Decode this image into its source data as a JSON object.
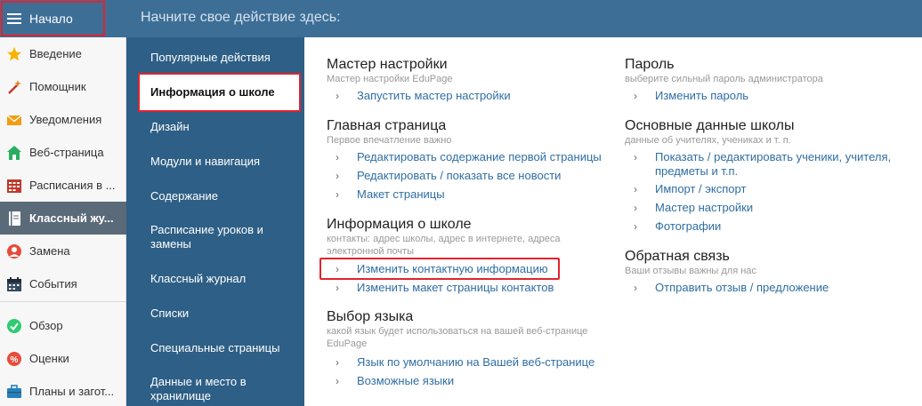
{
  "header": {
    "title": "Начните свое действие здесь:"
  },
  "sidebar": {
    "start_label": "Начало",
    "items": [
      {
        "label": "Введение",
        "icon": "star-icon"
      },
      {
        "label": "Помощник",
        "icon": "magic-wand-icon"
      },
      {
        "label": "Уведомления",
        "icon": "envelope-icon"
      },
      {
        "label": "Веб-страница",
        "icon": "home-icon"
      },
      {
        "label": "Расписания в ...",
        "icon": "timetable-icon"
      },
      {
        "label": "Классный жу...",
        "icon": "notebook-icon"
      },
      {
        "label": "Замена",
        "icon": "substitution-icon"
      },
      {
        "label": "События",
        "icon": "calendar-icon"
      },
      {
        "label": "Обзор",
        "icon": "check-circle-icon"
      },
      {
        "label": "Оценки",
        "icon": "grades-icon"
      },
      {
        "label": "Планы и загот...",
        "icon": "briefcase-icon"
      }
    ]
  },
  "categories": [
    "Популярные действия",
    "Информация о школе",
    "Дизайн",
    "Модули и навигация",
    "Содержание",
    "Расписание уроков и замены",
    "Классный журнал",
    "Списки",
    "Специальные страницы",
    "Данные и место в хранилище"
  ],
  "sections": {
    "wizard": {
      "title": "Мастер настройки",
      "desc": "Мастер настройки EduPage",
      "links": [
        "Запустить мастер настройки"
      ]
    },
    "homepage": {
      "title": "Главная страница",
      "desc": "Первое впечатление важно",
      "links": [
        "Редактировать содержание первой страницы",
        "Редактировать / показать все новости",
        "Макет страницы"
      ]
    },
    "schoolinfo": {
      "title": "Информация о школе",
      "desc": "контакты: адрес школы, адрес в интернете, адреса электронной почты",
      "links": [
        "Изменить контактную информацию",
        "Изменить макет страницы контактов"
      ]
    },
    "language": {
      "title": "Выбор языка",
      "desc": "какой язык будет использоваться на вашей веб-странице EduPage",
      "links": [
        "Язык по умолчанию на Вашей веб-странице",
        "Возможные языки"
      ]
    },
    "password": {
      "title": "Пароль",
      "desc": "выберите сильный пароль администратора",
      "links": [
        "Изменить пароль"
      ]
    },
    "basicdata": {
      "title": "Основные данные школы",
      "desc": "данные об учителях, учениках и т. п.",
      "links": [
        "Показать / редактировать ученики, учителя, предметы и т.п.",
        "Импорт / экспорт",
        "Мастер настройки",
        "Фотографии"
      ]
    },
    "feedback": {
      "title": "Обратная связь",
      "desc": "Ваши отзывы важны для нас",
      "links": [
        "Отправить отзыв / предложение"
      ]
    }
  },
  "colors": {
    "header": "#3d6e96",
    "category_bg": "#2e5f86",
    "link": "#2f6ea3",
    "highlight": "#e0242e",
    "active_item": "#5b6a78"
  }
}
